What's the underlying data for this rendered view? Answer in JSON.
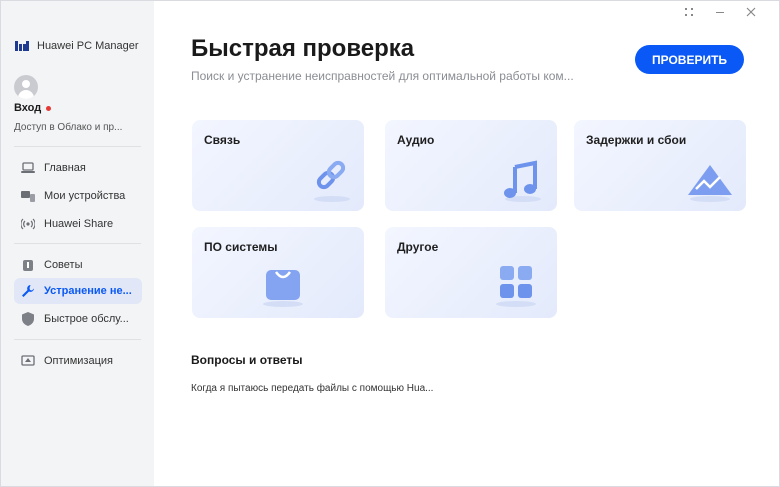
{
  "app": {
    "title": "Huawei PC Manager"
  },
  "user": {
    "login_label": "Вход",
    "cloud_text": "Доступ в Облако и пр..."
  },
  "nav": {
    "items": [
      {
        "label": "Главная",
        "icon": "laptop-icon"
      },
      {
        "label": "Мои устройства",
        "icon": "devices-icon"
      },
      {
        "label": "Huawei Share",
        "icon": "share-wave-icon"
      },
      {
        "label": "Советы",
        "icon": "tips-icon"
      },
      {
        "label": "Устранение не...",
        "icon": "wrench-icon",
        "active": true
      },
      {
        "label": "Быстрое обслу...",
        "icon": "service-icon"
      },
      {
        "label": "Оптимизация",
        "icon": "optimize-icon"
      }
    ]
  },
  "header": {
    "title": "Быстрая проверка",
    "subtitle": "Поиск и устранение неисправностей для оптимальной работы ком...",
    "check_button": "ПРОВЕРИТЬ"
  },
  "categories": [
    {
      "label": "Связь",
      "icon": "link-icon"
    },
    {
      "label": "Аудио",
      "icon": "music-note-icon"
    },
    {
      "label": "Задержки и сбои",
      "icon": "lag-triangle-icon"
    },
    {
      "label": "ПО системы",
      "icon": "software-bag-icon"
    },
    {
      "label": "Другое",
      "icon": "grid-icon"
    }
  ],
  "faq": {
    "title": "Вопросы и ответы",
    "items": [
      "Когда я пытаюсь передать файлы с помощью Hua..."
    ]
  },
  "colors": {
    "accent": "#0a59f7",
    "active_bg": "#e1e7f6",
    "sidebar_bg": "#f3f4f6",
    "notify_dot": "#e53935"
  }
}
